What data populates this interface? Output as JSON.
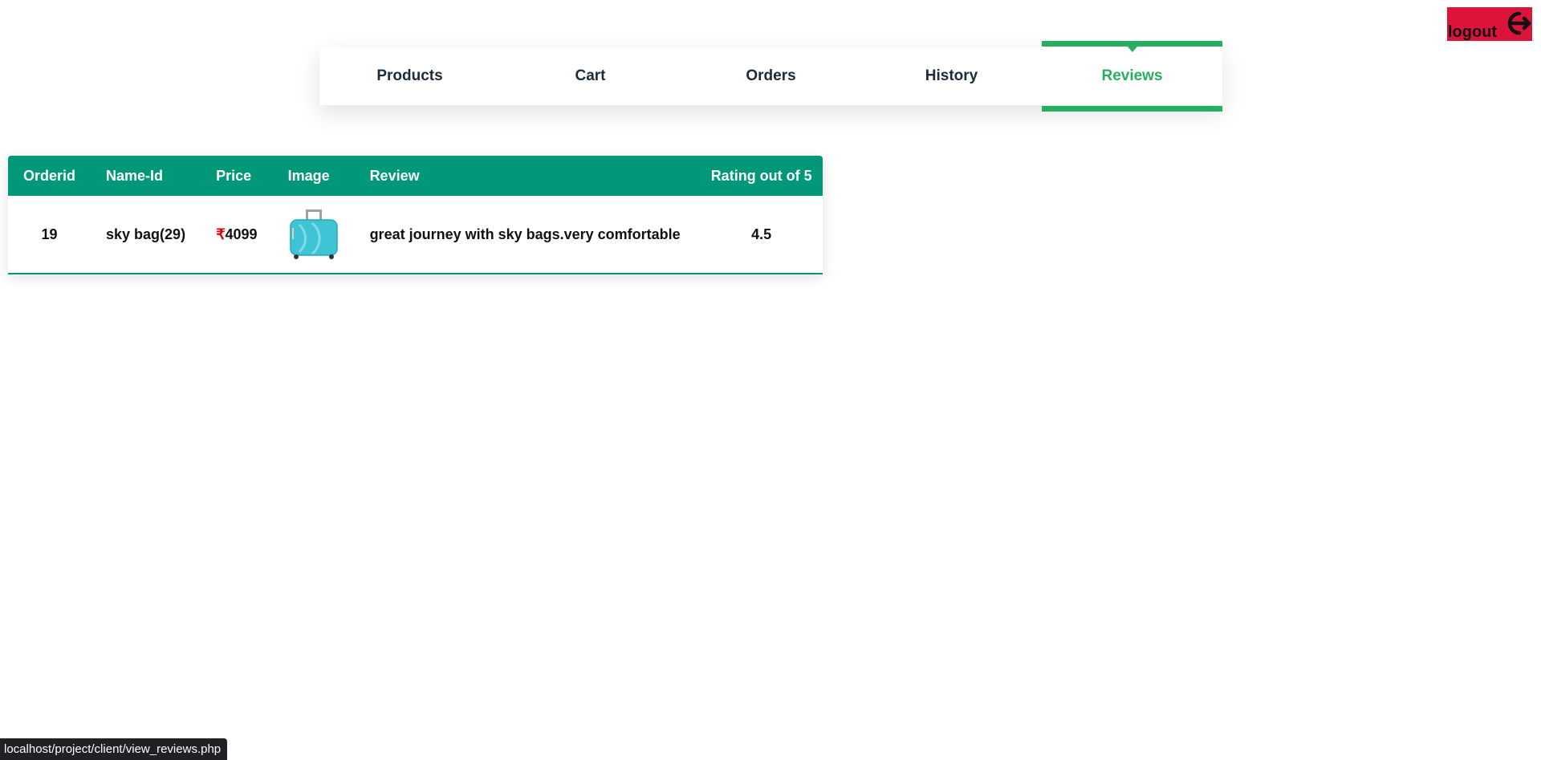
{
  "header": {
    "logout_label": "logout",
    "logout_icon": "power-icon"
  },
  "nav": {
    "tabs": [
      {
        "label": "Products",
        "active": false
      },
      {
        "label": "Cart",
        "active": false
      },
      {
        "label": "Orders",
        "active": false
      },
      {
        "label": "History",
        "active": false
      },
      {
        "label": "Reviews",
        "active": true
      }
    ]
  },
  "reviews_table": {
    "headers": [
      "Orderid",
      "Name-Id",
      "Price",
      "Image",
      "Review",
      "Rating out of 5"
    ],
    "rows": [
      {
        "orderid": "19",
        "name_id": "sky bag(29)",
        "currency": "₹",
        "price": "4099",
        "image": "suitcase-image",
        "review": "great journey with sky bags.very comfortable",
        "rating": "4.5"
      }
    ]
  },
  "status_bar": {
    "url": "localhost/project/client/view_reviews.php"
  },
  "colors": {
    "accent_green": "#27ae60",
    "table_header": "#009879",
    "logout_bg": "#dc143c",
    "rupee": "#e00000"
  }
}
